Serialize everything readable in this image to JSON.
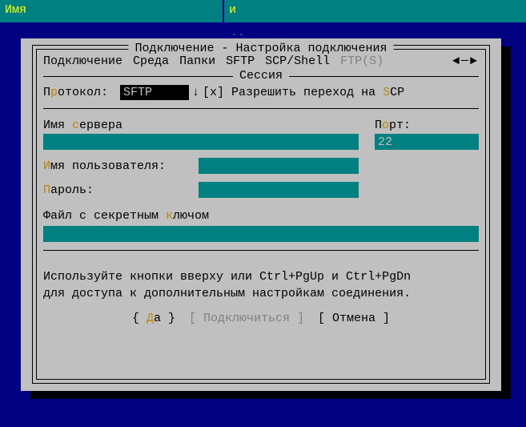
{
  "header": {
    "left": "Имя",
    "right": "и",
    "dots": ".."
  },
  "dialog": {
    "title": "Подключение - Настройка подключения",
    "tabs": {
      "items": [
        "Подключение",
        "Среда",
        "Папки",
        "SFTP",
        "SCP/Shell"
      ],
      "disabled": "FTP(S)"
    },
    "arrows": {
      "left": "◄",
      "sep": "─",
      "right": "►"
    },
    "section_title": "Сессия",
    "protocol": {
      "label_pre": "П",
      "label_hot": "р",
      "label_post": "отокол:",
      "value": "SFTP",
      "arrow": "↓"
    },
    "allow_scp": {
      "checkbox": "[x]",
      "pre": "Разрешить переход на ",
      "hot": "S",
      "post": "CP"
    },
    "host": {
      "pre": "Имя ",
      "hot": "с",
      "post": "ервера",
      "value": ""
    },
    "port": {
      "pre": "П",
      "hot": "о",
      "post": "рт:",
      "value": "22"
    },
    "user": {
      "hot": "И",
      "post": "мя пользователя:",
      "value": ""
    },
    "pass": {
      "hot": "П",
      "post": "ароль:",
      "value": ""
    },
    "keyfile": {
      "pre": "Файл с секретным ",
      "hot": "к",
      "post": "лючом",
      "value": ""
    },
    "hint1": "Используйте кнопки вверху или Ctrl+PgUp и Ctrl+PgDn",
    "hint2": "для доступа к дополнительным настройкам соединения.",
    "buttons": {
      "ok_pre": "{ ",
      "ok_hot": "Д",
      "ok_post": "а }",
      "connect": "[ Подключиться ]",
      "cancel": "[ Отмена ]"
    }
  }
}
